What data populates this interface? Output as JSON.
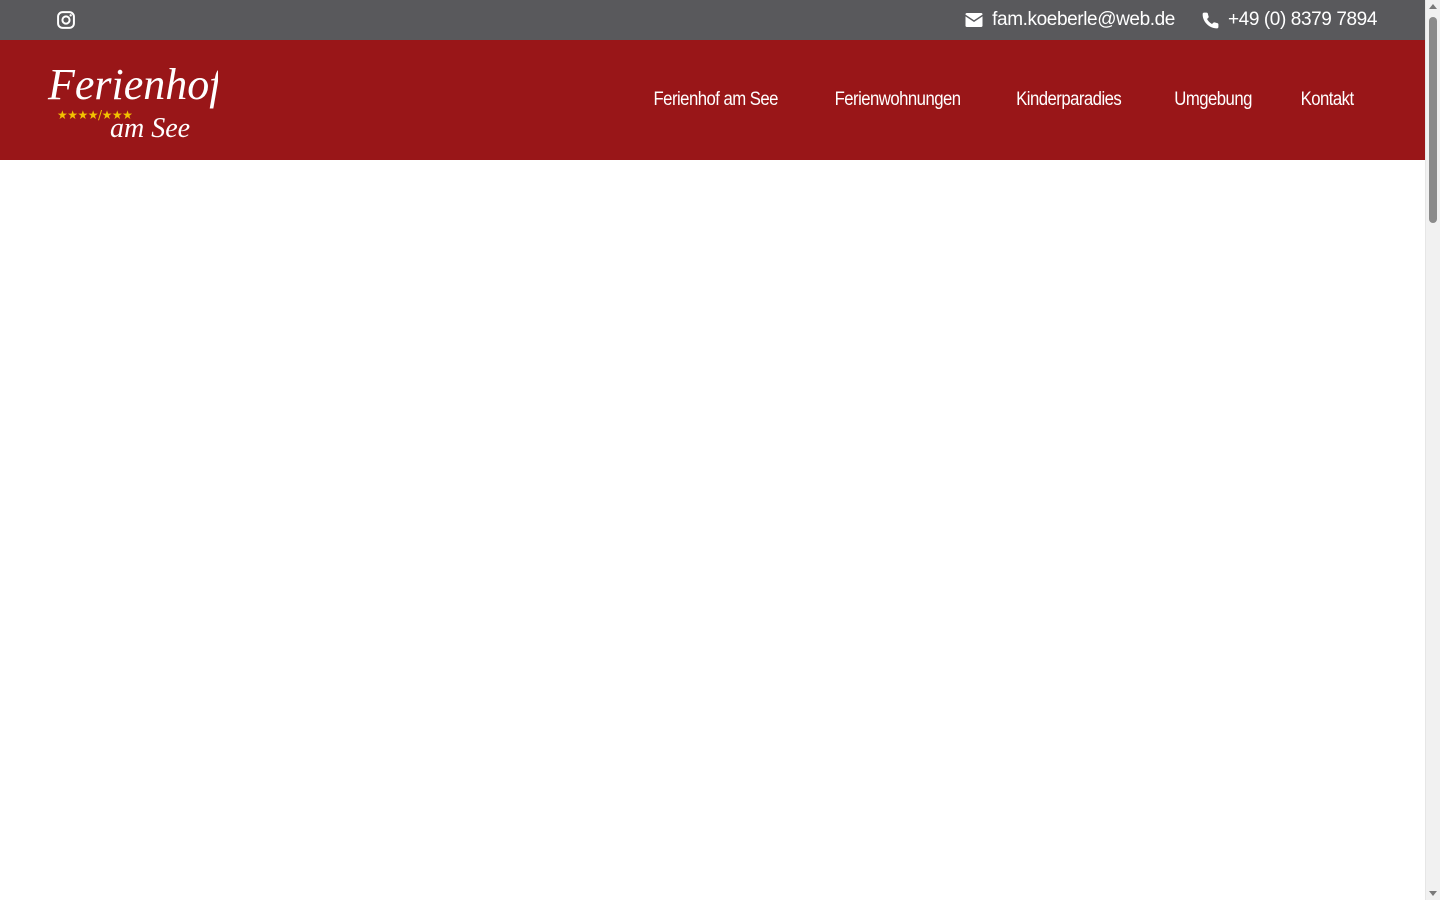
{
  "topbar": {
    "social_icon": "instagram-icon",
    "email": "fam.koeberle@web.de",
    "email_icon": "envelope-icon",
    "phone": "+49 (0) 8379 7894",
    "phone_icon": "phone-icon"
  },
  "logo": {
    "line1": "Ferienhof",
    "line2": "am See",
    "stars": "★★★★/★★★"
  },
  "nav": {
    "items": [
      {
        "label": "Ferienhof am See"
      },
      {
        "label": "Ferienwohnungen"
      },
      {
        "label": "Kinderparadies"
      },
      {
        "label": "Umgebung"
      },
      {
        "label": "Kontakt"
      }
    ]
  },
  "colors": {
    "topbar_bg": "#59595c",
    "header_bg": "#991618",
    "logo_stars": "#f2c200",
    "text": "#ffffff"
  }
}
